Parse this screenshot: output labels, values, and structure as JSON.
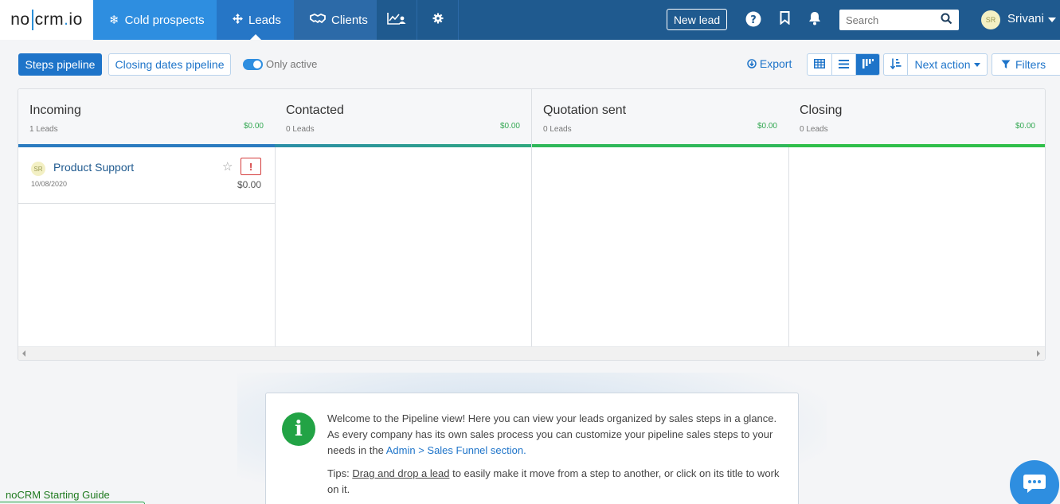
{
  "brand": {
    "logo_left": "no",
    "logo_right": "crm",
    "logo_dot": ".",
    "logo_tld": "io"
  },
  "nav": {
    "cold_prospects": "Cold prospects",
    "leads": "Leads",
    "clients": "Clients",
    "stats_icon": "chart-user-icon",
    "settings_icon": "gear-icon"
  },
  "header": {
    "new_lead": "New lead",
    "search_placeholder": "Search",
    "user_initials": "SR",
    "user_name": "Srivani"
  },
  "toolbar": {
    "steps_pipeline": "Steps pipeline",
    "closing_dates_pipeline": "Closing dates pipeline",
    "only_active": "Only active",
    "export": "Export",
    "next_action": "Next action",
    "filters": "Filters"
  },
  "colors": {
    "accent": "#1e74c9",
    "topbar": "#1f5a8f",
    "success": "#34a853",
    "stage_blue": "#2b7bc0",
    "stage_green": "#2fbf4a"
  },
  "pipeline": {
    "columns": [
      {
        "title": "Incoming",
        "count": "1 Leads",
        "amount": "$0.00"
      },
      {
        "title": "Contacted",
        "count": "0 Leads",
        "amount": "$0.00"
      },
      {
        "title": "Quotation sent",
        "count": "0 Leads",
        "amount": "$0.00"
      },
      {
        "title": "Closing",
        "count": "0 Leads",
        "amount": "$0.00"
      }
    ],
    "card": {
      "initials": "SR",
      "title": "Product Support",
      "date": "10/08/2020",
      "amount": "$0.00",
      "alert": "!"
    }
  },
  "info": {
    "line1": "Welcome to the Pipeline view! Here you can view your leads organized by sales steps in a glance.",
    "line2_prefix": "As every company has its own sales process you can customize your pipeline sales steps to your needs in the ",
    "line2_link": "Admin > Sales Funnel section.",
    "tips_label": "Tips: ",
    "tips_link": "Drag and drop a lead",
    "tips_rest": " to easily make it move from a step to another, or click on its title to work on it."
  },
  "footer": {
    "guide": "noCRM Starting Guide"
  }
}
